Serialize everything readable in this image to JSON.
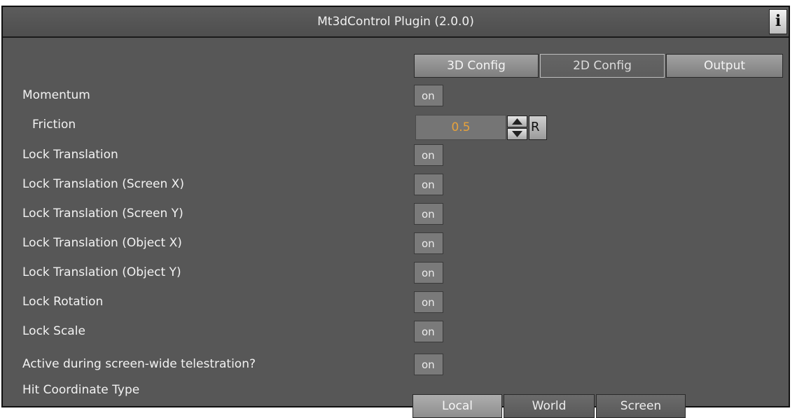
{
  "window": {
    "title": "Mt3dControl Plugin (2.0.0)",
    "info_glyph": "i",
    "info_icon": "info-icon"
  },
  "tabs": [
    {
      "label": "3D Config",
      "active": false
    },
    {
      "label": "2D Config",
      "active": true
    },
    {
      "label": "Output",
      "active": false
    }
  ],
  "momentum": {
    "label": "Momentum",
    "toggle": "on"
  },
  "friction": {
    "label": "Friction",
    "value": "0.5",
    "reset_label": "R"
  },
  "lock_rows": [
    {
      "label": "Lock Translation",
      "toggle": "on"
    },
    {
      "label": "Lock Translation (Screen X)",
      "toggle": "on"
    },
    {
      "label": "Lock Translation (Screen Y)",
      "toggle": "on"
    },
    {
      "label": "Lock Translation (Object X)",
      "toggle": "on"
    },
    {
      "label": "Lock Translation (Object Y)",
      "toggle": "on"
    },
    {
      "label": "Lock Rotation",
      "toggle": "on"
    },
    {
      "label": "Lock Scale",
      "toggle": "on"
    }
  ],
  "telestration": {
    "label": "Active during screen-wide telestration?",
    "toggle": "on"
  },
  "hit_coordinate": {
    "label": "Hit Coordinate Type",
    "options": [
      "Local",
      "World",
      "Screen"
    ],
    "selected": "Local"
  },
  "colors": {
    "panel": "#575757",
    "value_text": "#e7a23c"
  }
}
